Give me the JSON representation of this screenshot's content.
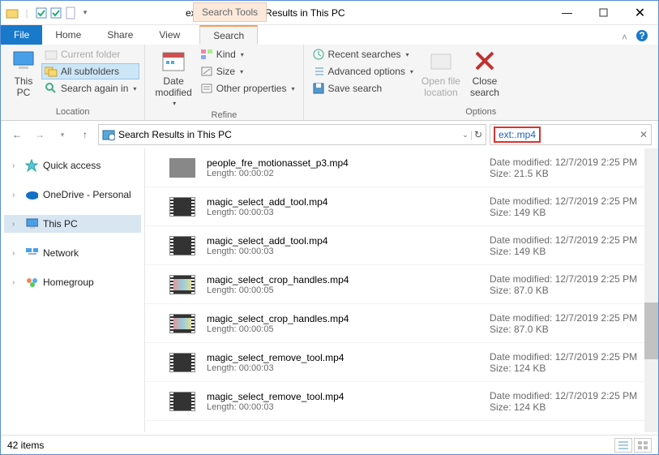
{
  "title": "ext:.mp4 - Search Results in This PC",
  "qat_label": "Search Tools",
  "tabs": {
    "file": "File",
    "home": "Home",
    "share": "Share",
    "view": "View",
    "search": "Search"
  },
  "ribbon": {
    "location": {
      "label": "Location",
      "this_pc": "This\nPC",
      "current_folder": "Current folder",
      "all_subfolders": "All subfolders",
      "search_again": "Search again in"
    },
    "refine": {
      "label": "Refine",
      "date_modified": "Date\nmodified",
      "kind": "Kind",
      "size": "Size",
      "other": "Other properties"
    },
    "options": {
      "label": "Options",
      "recent": "Recent searches",
      "advanced": "Advanced options",
      "save": "Save search",
      "open_loc": "Open file\nlocation",
      "close": "Close\nsearch"
    }
  },
  "address": "Search Results in This PC",
  "search_value": "ext:.mp4",
  "sidebar": [
    {
      "label": "Quick access",
      "icon": "star"
    },
    {
      "label": "OneDrive - Personal",
      "icon": "onedrive"
    },
    {
      "label": "This PC",
      "icon": "pc",
      "selected": true
    },
    {
      "label": "Network",
      "icon": "network"
    },
    {
      "label": "Homegroup",
      "icon": "homegroup"
    }
  ],
  "results": [
    {
      "name": "people_fre_motionasset_p3.mp4",
      "length": "00:00:02",
      "date": "12/7/2019 2:25 PM",
      "size": "21.5 KB",
      "thumb": "doc"
    },
    {
      "name": "magic_select_add_tool.mp4",
      "length": "00:00:03",
      "date": "12/7/2019 2:25 PM",
      "size": "149 KB",
      "thumb": "dark"
    },
    {
      "name": "magic_select_add_tool.mp4",
      "length": "00:00:03",
      "date": "12/7/2019 2:25 PM",
      "size": "149 KB",
      "thumb": "dark"
    },
    {
      "name": "magic_select_crop_handles.mp4",
      "length": "00:00:05",
      "date": "12/7/2019 2:25 PM",
      "size": "87.0 KB",
      "thumb": "light"
    },
    {
      "name": "magic_select_crop_handles.mp4",
      "length": "00:00:05",
      "date": "12/7/2019 2:25 PM",
      "size": "87.0 KB",
      "thumb": "light"
    },
    {
      "name": "magic_select_remove_tool.mp4",
      "length": "00:00:03",
      "date": "12/7/2019 2:25 PM",
      "size": "124 KB",
      "thumb": "dark"
    },
    {
      "name": "magic_select_remove_tool.mp4",
      "length": "00:00:03",
      "date": "12/7/2019 2:25 PM",
      "size": "124 KB",
      "thumb": "dark"
    }
  ],
  "meta_labels": {
    "length": "Length:",
    "date": "Date modified:",
    "size": "Size:"
  },
  "status": {
    "count": "42 items"
  }
}
